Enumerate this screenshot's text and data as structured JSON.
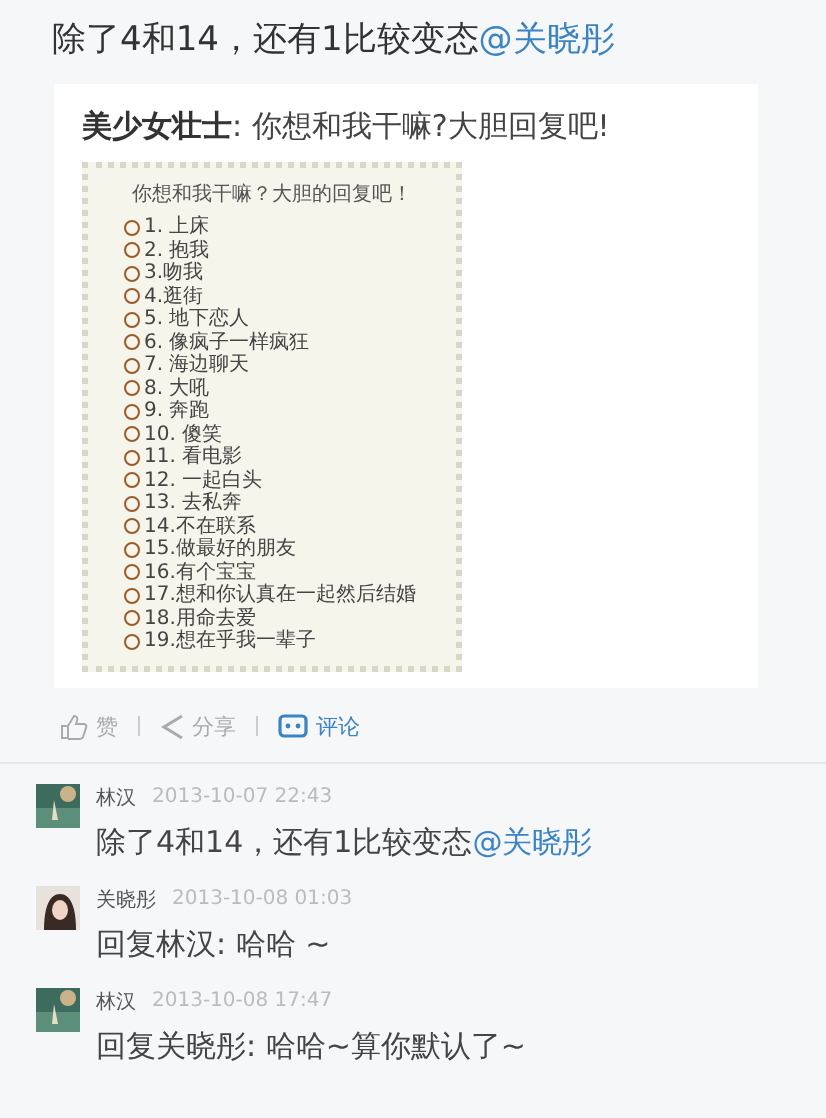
{
  "post": {
    "text": "除了4和14，还有1比较变态",
    "mention": "@关晓彤"
  },
  "card": {
    "author": "美少女壮士",
    "text": ": 你想和我干嘛?大胆回复吧!",
    "image": {
      "title": "你想和我干嘛？大胆的回复吧！",
      "items": [
        "1. 上床",
        "2. 抱我",
        "3.吻我",
        "4.逛街",
        "5. 地下恋人",
        "6. 像疯子一样疯狂",
        "7. 海边聊天",
        "8. 大吼",
        "9. 奔跑",
        "10. 傻笑",
        "11. 看电影",
        "12. 一起白头",
        "13. 去私奔",
        "14.不在联系",
        "15.做最好的朋友",
        "16.有个宝宝",
        "17.想和你认真在一起然后结婚",
        "18.用命去爱",
        "19.想在乎我一辈子"
      ]
    }
  },
  "actions": [
    {
      "kind": "like",
      "label": "赞",
      "selected": false
    },
    {
      "kind": "share",
      "label": "分享",
      "selected": false
    },
    {
      "kind": "comment",
      "label": "评论",
      "selected": true
    }
  ],
  "comments": [
    {
      "name": "林汉",
      "time": "2013-10-07 22:43",
      "text": "除了4和14，还有1比较变态",
      "mention": "@关晓彤"
    },
    {
      "name": "关晓彤",
      "time": "2013-10-08 01:03",
      "text": "回复林汉: 哈哈 ~"
    },
    {
      "name": "林汉",
      "time": "2013-10-08 17:47",
      "text": "回复关晓彤: 哈哈~算你默认了~"
    }
  ]
}
